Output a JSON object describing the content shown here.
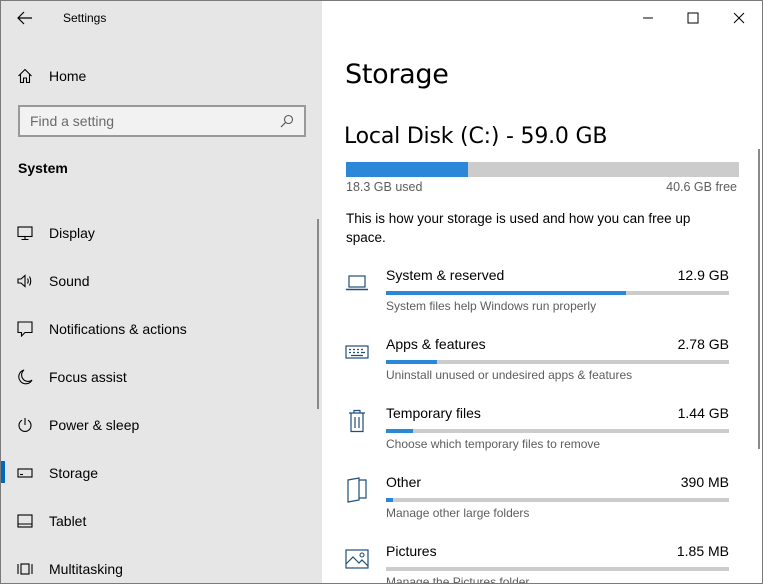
{
  "window": {
    "title": "Settings"
  },
  "sidebar": {
    "home_label": "Home",
    "search": {
      "placeholder": "Find a setting",
      "value": ""
    },
    "section_title": "System",
    "items": [
      {
        "label": "Display",
        "icon": "monitor-icon"
      },
      {
        "label": "Sound",
        "icon": "speaker-icon"
      },
      {
        "label": "Notifications & actions",
        "icon": "notification-icon"
      },
      {
        "label": "Focus assist",
        "icon": "moon-icon"
      },
      {
        "label": "Power & sleep",
        "icon": "power-icon"
      },
      {
        "label": "Storage",
        "icon": "storage-drive-icon",
        "selected": true
      },
      {
        "label": "Tablet",
        "icon": "tablet-icon"
      },
      {
        "label": "Multitasking",
        "icon": "multitasking-icon"
      }
    ]
  },
  "main": {
    "title": "Storage",
    "disk": {
      "title": "Local Disk (C:) - 59.0 GB",
      "used_label": "18.3 GB used",
      "free_label": "40.6 GB free",
      "used_fraction": 0.31
    },
    "description": "This is how your storage is used and how you can free up space.",
    "categories": [
      {
        "name": "System & reserved",
        "size": "12.9 GB",
        "hint": "System files help Windows run properly",
        "fraction": 0.7,
        "icon": "laptop-icon"
      },
      {
        "name": "Apps & features",
        "size": "2.78 GB",
        "hint": "Uninstall unused or undesired apps & features",
        "fraction": 0.15,
        "icon": "keyboard-icon"
      },
      {
        "name": "Temporary files",
        "size": "1.44 GB",
        "hint": "Choose which temporary files to remove",
        "fraction": 0.08,
        "icon": "trash-icon"
      },
      {
        "name": "Other",
        "size": "390 MB",
        "hint": "Manage other large folders",
        "fraction": 0.02,
        "icon": "folder-icon"
      },
      {
        "name": "Pictures",
        "size": "1.85 MB",
        "hint": "Manage the Pictures folder",
        "fraction": 0.0,
        "icon": "picture-icon"
      }
    ]
  },
  "colors": {
    "accent": "#2b88d8",
    "selection_marker": "#0067c0",
    "sidebar_bg": "#e6e6e6",
    "bar_track": "#cccccc"
  }
}
